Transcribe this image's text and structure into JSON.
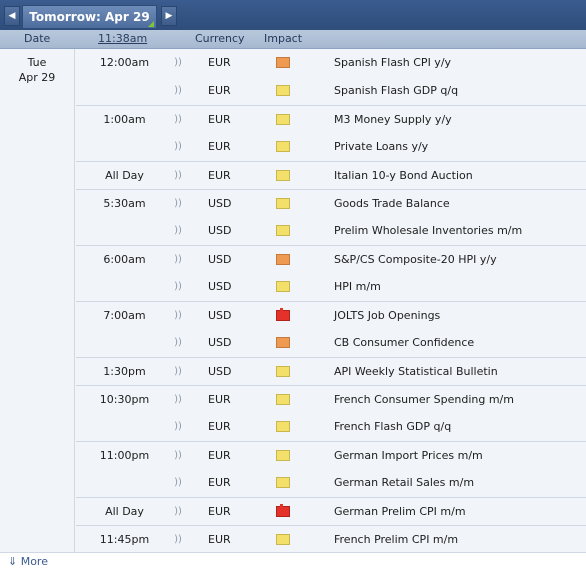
{
  "nav": {
    "prev_icon": "◀",
    "next_icon": "▶",
    "date_label": "Tomorrow: Apr 29"
  },
  "header": {
    "date": "Date",
    "time": "11:38am",
    "currency": "Currency",
    "impact": "Impact"
  },
  "day": {
    "weekday": "Tue",
    "date": "Apr 29"
  },
  "sound_glyph": "))",
  "events": [
    {
      "time": "12:00am",
      "currency": "EUR",
      "impact": "medium",
      "event": "Spanish Flash CPI y/y"
    },
    {
      "time": "",
      "currency": "EUR",
      "impact": "low",
      "event": "Spanish Flash GDP q/q"
    },
    {
      "time": "1:00am",
      "currency": "EUR",
      "impact": "low",
      "event": "M3 Money Supply y/y"
    },
    {
      "time": "",
      "currency": "EUR",
      "impact": "low",
      "event": "Private Loans y/y"
    },
    {
      "time": "All Day",
      "currency": "EUR",
      "impact": "low",
      "event": "Italian 10-y Bond Auction"
    },
    {
      "time": "5:30am",
      "currency": "USD",
      "impact": "low",
      "event": "Goods Trade Balance"
    },
    {
      "time": "",
      "currency": "USD",
      "impact": "low",
      "event": "Prelim Wholesale Inventories m/m"
    },
    {
      "time": "6:00am",
      "currency": "USD",
      "impact": "medium",
      "event": "S&P/CS Composite-20 HPI y/y"
    },
    {
      "time": "",
      "currency": "USD",
      "impact": "low",
      "event": "HPI m/m"
    },
    {
      "time": "7:00am",
      "currency": "USD",
      "impact": "high",
      "event": "JOLTS Job Openings"
    },
    {
      "time": "",
      "currency": "USD",
      "impact": "medium",
      "event": "CB Consumer Confidence"
    },
    {
      "time": "1:30pm",
      "currency": "USD",
      "impact": "low",
      "event": "API Weekly Statistical Bulletin"
    },
    {
      "time": "10:30pm",
      "currency": "EUR",
      "impact": "low",
      "event": "French Consumer Spending m/m"
    },
    {
      "time": "",
      "currency": "EUR",
      "impact": "low",
      "event": "French Flash GDP q/q"
    },
    {
      "time": "11:00pm",
      "currency": "EUR",
      "impact": "low",
      "event": "German Import Prices m/m"
    },
    {
      "time": "",
      "currency": "EUR",
      "impact": "low",
      "event": "German Retail Sales m/m"
    },
    {
      "time": "All Day",
      "currency": "EUR",
      "impact": "high",
      "event": "German Prelim CPI m/m"
    },
    {
      "time": "11:45pm",
      "currency": "EUR",
      "impact": "low",
      "event": "French Prelim CPI m/m"
    }
  ],
  "footer": {
    "more_label": "⇓ More"
  }
}
